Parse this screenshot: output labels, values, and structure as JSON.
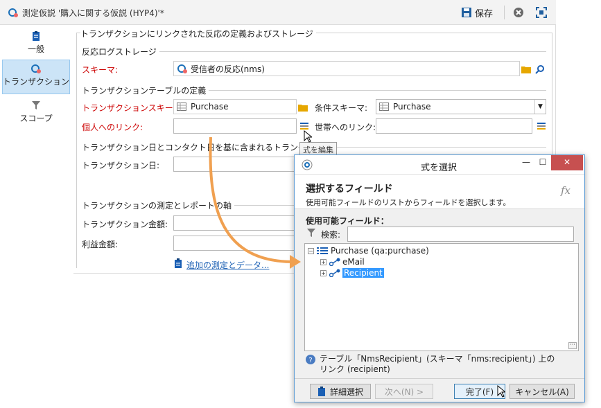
{
  "window": {
    "title": "測定仮説 '購入に関する仮説 (HYP4)'*",
    "save_label": "保存"
  },
  "sidebar": {
    "items": [
      {
        "label": "一般",
        "icon": "clipboard-icon"
      },
      {
        "label": "トランザクション",
        "icon": "transaction-icon"
      },
      {
        "label": "スコープ",
        "icon": "funnel-icon"
      }
    ]
  },
  "main": {
    "section_title": "トランザクションにリンクされた反応の定義およびストレージ",
    "response_log": {
      "title": "反応ログストレージ",
      "schema_label": "スキーマ:",
      "schema_value": "受信者の反応(nms)"
    },
    "transaction_table": {
      "title": "トランザクションテーブルの定義",
      "schema_label": "トランザクションスキーマ:",
      "schema_value": "Purchase",
      "cond_schema_label": "条件スキーマ:",
      "cond_schema_value": "Purchase",
      "person_link_label": "個人へのリンク:",
      "person_link_value": "",
      "household_link_label": "世帯へのリンク:",
      "household_link_value": ""
    },
    "dates": {
      "title": "トランザクション日とコンタクト日を基に含まれるトランザクション",
      "date_label": "トランザクション日:"
    },
    "axes": {
      "title": "トランザクションの測定とレポートの軸",
      "amount_label": "トランザクション金額:",
      "profit_label": "利益金額:",
      "add_link": "追加の測定とデータ..."
    },
    "tooltip": "式を編集"
  },
  "dialog": {
    "title": "式を選択",
    "heading": "選択するフィールド",
    "subheading": "使用可能フィールドのリストからフィールドを選択します。",
    "fx": "fx",
    "fields_label": "使用可能フィールド：",
    "search_label": "検索:",
    "search_value": "",
    "tree": {
      "root": "Purchase (qa:purchase)",
      "children": [
        "eMail",
        "Recipient"
      ]
    },
    "info": "テーブル「NmsRecipient」(スキーマ「nms:recipient」) 上のリンク (recipient)",
    "buttons": {
      "advanced": "詳細選択",
      "next": "次へ(N) >",
      "finish": "完了(F)",
      "cancel": "キャンセル(A)"
    }
  },
  "colors": {
    "accent": "#1a5fb4",
    "required": "#cc0000",
    "arrow": "#f0a050",
    "selection": "#3399ff"
  }
}
